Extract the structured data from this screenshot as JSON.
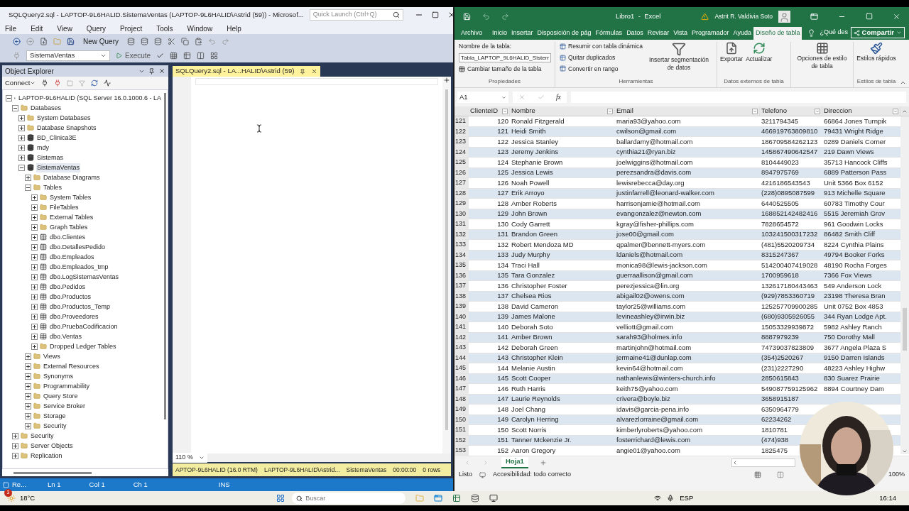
{
  "ssms": {
    "title": "SQLQuery2.sql - LAPTOP-9L6HALID.SistemaVentas (LAPTOP-9L6HALID\\Astrid (59)) - Microsof...",
    "quick_launch": {
      "placeholder": "Quick Launch (Ctrl+Q)"
    },
    "menu": [
      "File",
      "Edit",
      "View",
      "Query",
      "Project",
      "Tools",
      "Window",
      "Help"
    ],
    "new_query": "New Query",
    "database": "SistemaVentas",
    "execute": "Execute",
    "object_explorer": {
      "title": "Object Explorer",
      "connect": "Connect",
      "tree": [
        {
          "label": "LAPTOP-9L6HALID (SQL Server 16.0.1000.6 - LA",
          "kind": "server",
          "expanded": true,
          "selected": false,
          "children": [
            {
              "label": "Databases",
              "kind": "folder",
              "expanded": true,
              "selected": false,
              "children": [
                {
                  "label": "System Databases",
                  "kind": "folder",
                  "expanded": false,
                  "selected": false
                },
                {
                  "label": "Database Snapshots",
                  "kind": "folder",
                  "expanded": false,
                  "selected": false
                },
                {
                  "label": "BD_Clinica3E",
                  "kind": "database",
                  "expanded": false,
                  "selected": false
                },
                {
                  "label": "mdy",
                  "kind": "database",
                  "expanded": false,
                  "selected": false
                },
                {
                  "label": "Sistemas",
                  "kind": "database",
                  "expanded": false,
                  "selected": false
                },
                {
                  "label": "SistemaVentas",
                  "kind": "database",
                  "expanded": true,
                  "selected": true,
                  "children": [
                    {
                      "label": "Database Diagrams",
                      "kind": "folder",
                      "expanded": false,
                      "selected": false
                    },
                    {
                      "label": "Tables",
                      "kind": "folder",
                      "expanded": true,
                      "selected": false,
                      "children": [
                        {
                          "label": "System Tables",
                          "kind": "folder",
                          "expanded": false,
                          "selected": false
                        },
                        {
                          "label": "FileTables",
                          "kind": "folder",
                          "expanded": false,
                          "selected": false
                        },
                        {
                          "label": "External Tables",
                          "kind": "folder",
                          "expanded": false,
                          "selected": false
                        },
                        {
                          "label": "Graph Tables",
                          "kind": "folder",
                          "expanded": false,
                          "selected": false
                        },
                        {
                          "label": "dbo.Clientes",
                          "kind": "table",
                          "expanded": false,
                          "selected": false
                        },
                        {
                          "label": "dbo.DetallesPedido",
                          "kind": "table",
                          "expanded": false,
                          "selected": false
                        },
                        {
                          "label": "dbo.Empleados",
                          "kind": "table",
                          "expanded": false,
                          "selected": false
                        },
                        {
                          "label": "dbo.Empleados_tmp",
                          "kind": "table",
                          "expanded": false,
                          "selected": false
                        },
                        {
                          "label": "dbo.LogSistemasVentas",
                          "kind": "table",
                          "expanded": false,
                          "selected": false
                        },
                        {
                          "label": "dbo.Pedidos",
                          "kind": "table",
                          "expanded": false,
                          "selected": false
                        },
                        {
                          "label": "dbo.Productos",
                          "kind": "table",
                          "expanded": false,
                          "selected": false
                        },
                        {
                          "label": "dbo.Productos_Temp",
                          "kind": "table",
                          "expanded": false,
                          "selected": false
                        },
                        {
                          "label": "dbo.Proveedores",
                          "kind": "table",
                          "expanded": false,
                          "selected": false
                        },
                        {
                          "label": "dbo.PruebaCodificacion",
                          "kind": "table",
                          "expanded": false,
                          "selected": false
                        },
                        {
                          "label": "dbo.Ventas",
                          "kind": "table",
                          "expanded": false,
                          "selected": false
                        },
                        {
                          "label": "Dropped Ledger Tables",
                          "kind": "folder",
                          "expanded": false,
                          "selected": false
                        }
                      ]
                    },
                    {
                      "label": "Views",
                      "kind": "folder",
                      "expanded": false,
                      "selected": false
                    },
                    {
                      "label": "External Resources",
                      "kind": "folder",
                      "expanded": false,
                      "selected": false
                    },
                    {
                      "label": "Synonyms",
                      "kind": "folder",
                      "expanded": false,
                      "selected": false
                    },
                    {
                      "label": "Programmability",
                      "kind": "folder",
                      "expanded": false,
                      "selected": false
                    },
                    {
                      "label": "Query Store",
                      "kind": "folder",
                      "expanded": false,
                      "selected": false
                    },
                    {
                      "label": "Service Broker",
                      "kind": "folder",
                      "expanded": false,
                      "selected": false
                    },
                    {
                      "label": "Storage",
                      "kind": "folder",
                      "expanded": false,
                      "selected": false
                    },
                    {
                      "label": "Security",
                      "kind": "folder",
                      "expanded": false,
                      "selected": false
                    }
                  ]
                }
              ]
            },
            {
              "label": "Security",
              "kind": "folder",
              "expanded": false,
              "selected": false
            },
            {
              "label": "Server Objects",
              "kind": "folder",
              "expanded": false,
              "selected": false
            },
            {
              "label": "Replication",
              "kind": "folder",
              "expanded": false,
              "selected": false
            }
          ]
        }
      ]
    },
    "editor_tab": {
      "label": "SQLQuery2.sql - LA...HALID\\Astrid (59)",
      "selected": true
    },
    "zoom": "110 %",
    "query_status": [
      "APTOP-9L6HALID (16.0 RTM)",
      "LAPTOP-9L6HALID\\Astrid...",
      "SistemaVentas",
      "00:00:00",
      "0 rows"
    ],
    "status_bar": [
      "Re...",
      "Ln 1",
      "Col 1",
      "Ch 1",
      "INS"
    ]
  },
  "excel": {
    "title": "Libro1  -  Excel",
    "user": "Astrit R. Valdivia Soto",
    "tabs": [
      {
        "label": "Archivo",
        "selected": false
      },
      {
        "label": "Inicio",
        "selected": false
      },
      {
        "label": "Insertar",
        "selected": false
      },
      {
        "label": "Disposición de pág",
        "selected": false
      },
      {
        "label": "Fórmulas",
        "selected": false
      },
      {
        "label": "Datos",
        "selected": false
      },
      {
        "label": "Revisar",
        "selected": false
      },
      {
        "label": "Vista",
        "selected": false
      },
      {
        "label": "Programador",
        "selected": false
      },
      {
        "label": "Ayuda",
        "selected": false
      },
      {
        "label": "Diseño de tabla",
        "selected": true
      }
    ],
    "tell_me": "¿Qué des",
    "share": "Compartir",
    "ribbon": {
      "table_name_label": "Nombre de la tabla:",
      "table_name": "Tabla_LAPTOP_9L6HALID_Sistem",
      "resize": "Cambiar tamaño de la tabla",
      "group_1": "Propiedades",
      "tools": [
        "Resumir con tabla dinámica",
        "Quitar duplicados",
        "Convertir en rango"
      ],
      "slicer": "Insertar segmentación de datos",
      "group_2": "Herramientas",
      "export": "Exportar",
      "refresh": "Actualizar",
      "group_3": "Datos externos de tabla",
      "style_options": "Opciones de estilo de tabla",
      "quick_styles": "Estilos rápidos",
      "group_4": "Estilos de tabla"
    },
    "name_box": "A1",
    "fx": "fx",
    "columns": [
      "ClienteID",
      "Nombre",
      "Email",
      "Telefono",
      "Direccion"
    ],
    "rows": [
      {
        "number": "121",
        "cells": [
          "120",
          "Ronald Fitzgerald",
          "maria93@yahoo.com",
          "3211794345",
          "66864 Jones Turnpik"
        ]
      },
      {
        "number": "122",
        "cells": [
          "121",
          "Heidi Smith",
          "cwilson@gmail.com",
          "466919763809810",
          "79431 Wright Ridge"
        ]
      },
      {
        "number": "123",
        "cells": [
          "122",
          "Jessica Stanley",
          "ballardamy@hotmail.com",
          "186709584262123",
          "0289 Daniels Corner"
        ]
      },
      {
        "number": "124",
        "cells": [
          "123",
          "Jeremy Jenkins",
          "cynthia21@ryan.biz",
          "145867490642547",
          "219 Dawn Views"
        ]
      },
      {
        "number": "125",
        "cells": [
          "124",
          "Stephanie Brown",
          "joelwiggins@hotmail.com",
          "8104449023",
          "35713 Hancock Cliffs"
        ]
      },
      {
        "number": "126",
        "cells": [
          "125",
          "Jessica Lewis",
          "perezsandra@davis.com",
          "8947975769",
          "6889 Patterson Pass"
        ]
      },
      {
        "number": "127",
        "cells": [
          "126",
          "Noah Powell",
          "lewisrebecca@day.org",
          "4216186543543",
          "Unit 5366 Box 6152"
        ]
      },
      {
        "number": "128",
        "cells": [
          "127",
          "Erik Arroyo",
          "justinfarrell@leonard-walker.com",
          "(228)0895087599",
          "913 Michelle Square"
        ]
      },
      {
        "number": "129",
        "cells": [
          "128",
          "Amber Roberts",
          "harrisonjamie@hotmail.com",
          "6440525505",
          "60783 Timothy Cour"
        ]
      },
      {
        "number": "130",
        "cells": [
          "129",
          "John Brown",
          "evangonzalez@newton.com",
          "168852142482416",
          "5515 Jeremiah Grov"
        ]
      },
      {
        "number": "131",
        "cells": [
          "130",
          "Cody Garrett",
          "kgray@fisher-phillips.com",
          "7828654572",
          "961 Goodwin Locks"
        ]
      },
      {
        "number": "132",
        "cells": [
          "131",
          "Brandon Green",
          "jose00@gmail.com",
          "103241500317232",
          "86482 Smith Cliff"
        ]
      },
      {
        "number": "133",
        "cells": [
          "132",
          "Robert Mendoza MD",
          "qpalmer@bennett-myers.com",
          "(481)5520209734",
          "8224 Cynthia Plains"
        ]
      },
      {
        "number": "134",
        "cells": [
          "133",
          "Judy Murphy",
          "ldaniels@hotmail.com",
          "8315247367",
          "49794 Booker Forks"
        ]
      },
      {
        "number": "135",
        "cells": [
          "134",
          "Traci Hall",
          "monica98@lewis-jackson.com",
          "514200407419028",
          "48190 Rocha Forges"
        ]
      },
      {
        "number": "136",
        "cells": [
          "135",
          "Tara Gonzalez",
          "guerraallison@gmail.com",
          "1700959618",
          "7366 Fox Views"
        ]
      },
      {
        "number": "137",
        "cells": [
          "136",
          "Christopher Foster",
          "perezjessica@lin.org",
          "132617180443463",
          "549 Anderson Lock"
        ]
      },
      {
        "number": "138",
        "cells": [
          "137",
          "Chelsea Rios",
          "abigail02@owens.com",
          "(929)7853360719",
          "23198 Theresa Bran"
        ]
      },
      {
        "number": "139",
        "cells": [
          "138",
          "David Cameron",
          "taylor25@williams.com",
          "125257709900285",
          "Unit 0752 Box 4853"
        ]
      },
      {
        "number": "140",
        "cells": [
          "139",
          "James Malone",
          "levineashley@irwin.biz",
          "(680)9305926055",
          "344 Ryan Lodge Apt."
        ]
      },
      {
        "number": "141",
        "cells": [
          "140",
          "Deborah Soto",
          "velliott@gmail.com",
          "15053329939872",
          "5982 Ashley Ranch"
        ]
      },
      {
        "number": "142",
        "cells": [
          "141",
          "Amber Brown",
          "sarah93@holmes.info",
          "8887979239",
          "750 Dorothy Mall"
        ]
      },
      {
        "number": "143",
        "cells": [
          "142",
          "Deborah Green",
          "martinjohn@hotmail.com",
          "74739037823809",
          "3677 Angela Plaza S"
        ]
      },
      {
        "number": "144",
        "cells": [
          "143",
          "Christopher Klein",
          "jermaine41@dunlap.com",
          "(354)2520267",
          "9150 Darren Islands"
        ]
      },
      {
        "number": "145",
        "cells": [
          "144",
          "Melanie Austin",
          "kevin64@hotmail.com",
          "(231)2227290",
          "48223 Ashley Highw"
        ]
      },
      {
        "number": "146",
        "cells": [
          "145",
          "Scott Cooper",
          "nathanlewis@winters-church.info",
          "2850615843",
          "830 Suarez Prairie"
        ]
      },
      {
        "number": "147",
        "cells": [
          "146",
          "Ruth Harris",
          "keith75@yahoo.com",
          "549087759125962",
          "8894 Courtney Dam"
        ]
      },
      {
        "number": "148",
        "cells": [
          "147",
          "Laurie Reynolds",
          "crivera@boyle.biz",
          "3658915187"
        ]
      },
      {
        "number": "149",
        "cells": [
          "148",
          "Joel Chang",
          "idavis@garcia-pena.info",
          "6350964779"
        ]
      },
      {
        "number": "150",
        "cells": [
          "149",
          "Carolyn Herring",
          "alvarezlorraine@gmail.com",
          "62234262"
        ]
      },
      {
        "number": "151",
        "cells": [
          "150",
          "Scott Norris",
          "kimberlyroberts@yahoo.com",
          "1810781"
        ]
      },
      {
        "number": "152",
        "cells": [
          "151",
          "Tanner Mckenzie Jr.",
          "fosterrichard@lewis.com",
          "(474)938"
        ]
      },
      {
        "number": "153",
        "cells": [
          "152",
          "Aaron Gregory",
          "angie01@yahoo.com",
          "1825475"
        ]
      }
    ],
    "sheet_tab": {
      "label": "Hoja1",
      "selected": true
    },
    "status": "Listo",
    "accessibility": "Accesibilidad: todo correcto",
    "zoom": "100%"
  },
  "taskbar": {
    "weather_badge": "3",
    "temperature": "18°C",
    "search": {
      "placeholder": "Buscar"
    },
    "language": "ESP",
    "time": "16:14"
  }
}
